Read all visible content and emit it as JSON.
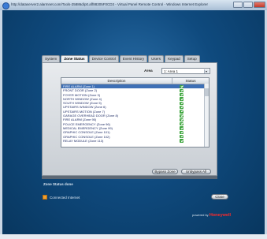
{
  "window": {
    "title": "http://dataserver2.alarmnet.com/Tools-25886d/p0.aff88305F0CD3 - Virtual Panel Remote Control - Windows Internet Explorer"
  },
  "tabs": [
    "System",
    "Zone Status",
    "Device Control",
    "Event History",
    "Users",
    "Keypad",
    "Setup"
  ],
  "active_tab": "Zone Status",
  "area": {
    "label": "Area",
    "selected": "1: Area 1"
  },
  "table": {
    "columns": [
      "Description",
      "Status"
    ],
    "rows": [
      {
        "description": "FIRE ALARM    (Zone 1)",
        "status": "ok"
      },
      {
        "description": "FRONT DOOR    (Zone 2)",
        "status": "ok"
      },
      {
        "description": "FOYER MOTION    (Zone 3)",
        "status": "ok"
      },
      {
        "description": "NORTH WINDOW    (Zone 4)",
        "status": "ok"
      },
      {
        "description": "SOUTH WINDOW    (Zone 5)",
        "status": "ok"
      },
      {
        "description": "UPSTAIRS WINDOW    (Zone 6)",
        "status": "ok"
      },
      {
        "description": "UPSTAIRS MOTION    (Zone 7)",
        "status": "ok"
      },
      {
        "description": "GARAGE OVERHEAD DOOR    (Zone 8)",
        "status": "ok"
      },
      {
        "description": "FIRE ALARM    (Zone 95)",
        "status": "ok"
      },
      {
        "description": "POLICE EMERGENCY    (Zone 96)",
        "status": "ok"
      },
      {
        "description": "MEDICAL EMERGENCY    (Zone 99)",
        "status": "ok"
      },
      {
        "description": "GRAPHIC CONSOLE    (Zone 101)",
        "status": "ok"
      },
      {
        "description": "GRAPHIC CONSOLE    (Zone 102)",
        "status": "ok"
      },
      {
        "description": "RELAY MODULE    (Zone 113)",
        "status": "ok"
      }
    ]
  },
  "buttons": {
    "bypass": "Bypass Zone",
    "unbypass": "Unbypass All",
    "close": "Close"
  },
  "status_text": "Zone Status done",
  "connection": "Connected Internet",
  "powered_by": {
    "prefix": "powered by",
    "brand": "Honeywell"
  },
  "colors": {
    "selected_row": "#3d6fb5",
    "status_ok": "#3aa43a",
    "brand": "#ff2a2a"
  }
}
